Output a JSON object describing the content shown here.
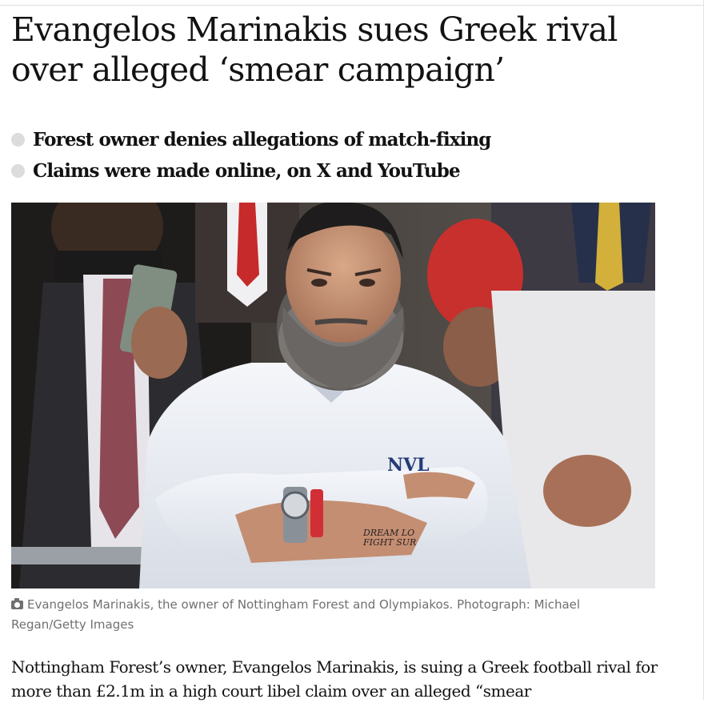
{
  "article": {
    "headline": "Evangelos Marinakis sues Greek rival over alleged ‘smear campaign’",
    "standfirst": [
      "Forest owner denies allegations of match-fixing",
      "Claims were made online, on X and YouTube"
    ],
    "image": {
      "tattoo_line1": "DREAM LO",
      "tattoo_line2": "FIGHT SUR",
      "shirt_logo": "NVL"
    },
    "caption": "Evangelos Marinakis, the owner of Nottingham Forest and Olympiakos. Photograph: Michael Regan/Getty Images",
    "body": "Nottingham Forest’s owner, Evangelos Marinakis, is suing a Greek football rival for more than £2.1m in a high court libel claim over an alleged “smear"
  },
  "icons": {
    "caption_icon": "camera-icon",
    "bullet_icon": "bullet-dot"
  },
  "colors": {
    "text": "#121212",
    "caption": "#707070",
    "bullet": "#dcdcdc"
  }
}
